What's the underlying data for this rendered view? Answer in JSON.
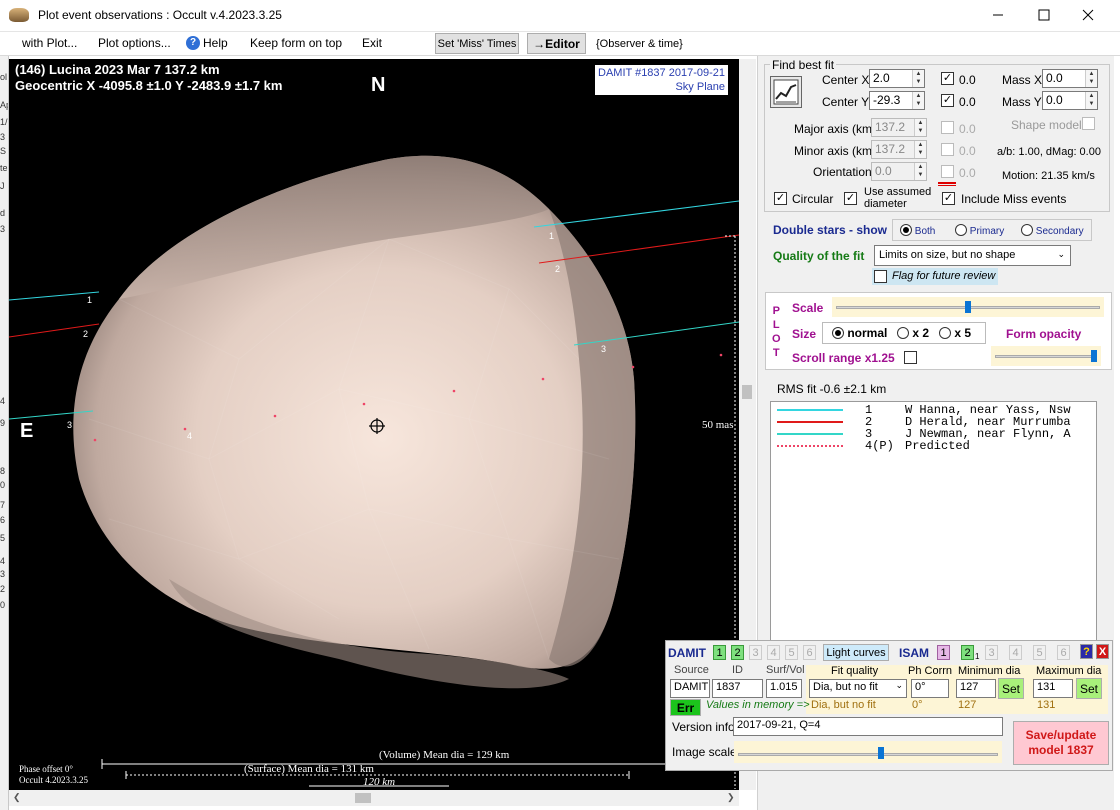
{
  "window": {
    "title": "Plot event observations : Occult v.4.2023.3.25"
  },
  "menu": {
    "with_plot": "with Plot...",
    "plot_options": "Plot options...",
    "help": "Help",
    "keep_form": "Keep form on top",
    "exit": "Exit",
    "set_miss": "Set 'Miss' Times",
    "editor": "→Editor",
    "observer_time": "{Observer & time}"
  },
  "plot": {
    "title_line1": "(146) Lucina  2023 Mar 7   137.2 km",
    "title_line2": "Geocentric  X  -4095.8 ±1.0  Y -2483.9 ±1.7 km",
    "damit_label": "DAMIT #1837 2017-09-21",
    "sky_plane": "Sky Plane",
    "north": "N",
    "east": "E",
    "scale_mas": "50 mas",
    "volume_dia": "(Volume) Mean dia = 129 km",
    "surface_dia": "(Surface) Mean dia = 131 km",
    "scale_km": "120 km",
    "phase_offset": "Phase offset 0°",
    "occult_version": "Occult 4.2023.3.25",
    "chord_labels": [
      "1",
      "2",
      "3",
      "4"
    ]
  },
  "fit": {
    "group_title": "Find best fit",
    "center_x_label": "Center X",
    "center_x": "2.0",
    "center_y_label": "Center Y",
    "center_y": "-29.3",
    "cx_val": "0.0",
    "cy_val": "0.0",
    "mass_x_label": "Mass X",
    "mass_x": "0.0",
    "mass_y_label": "Mass Y",
    "mass_y": "0.0",
    "major_label": "Major axis (km)",
    "major": "137.2",
    "major_val": "0.0",
    "minor_label": "Minor axis (km)",
    "minor": "137.2",
    "minor_val": "0.0",
    "orient_label": "Orientation",
    "orient": "0.0",
    "orient_val": "0.0",
    "shape_model": "Shape model",
    "ab_dmag": "a/b: 1.00, dMag: 0.00",
    "motion": "Motion: 21.35 km/s",
    "circular": "Circular",
    "use_assumed": "Use assumed",
    "diameter": "diameter",
    "include_miss": "Include Miss events"
  },
  "double_stars": {
    "label": "Double stars - show",
    "both": "Both",
    "primary": "Primary",
    "secondary": "Secondary"
  },
  "quality": {
    "label": "Quality of the fit",
    "value": "Limits on size, but no shape",
    "flag": "Flag for future review"
  },
  "plotpanel": {
    "plot_vert": [
      "P",
      "L",
      "O",
      "T"
    ],
    "scale": "Scale",
    "size": "Size",
    "normal": "normal",
    "x2": "x 2",
    "x5": "x 5",
    "form_opacity": "Form opacity",
    "scroll_range": "Scroll range x1.25",
    "scale_level": 0.5,
    "opacity_level": 1.0
  },
  "rms": "RMS fit -0.6 ±2.1 km",
  "legend": [
    {
      "num": "1",
      "name": "W Hanna, near Yass, Nsw",
      "color": "#33d6e0",
      "style": "solid"
    },
    {
      "num": "2",
      "name": "D Herald, near Murrumba",
      "color": "#e01a1a",
      "style": "solid"
    },
    {
      "num": "3",
      "name": "J Newman, near Flynn, A",
      "color": "#33d6c8",
      "style": "solid"
    },
    {
      "num": "4(P)",
      "name": "Predicted",
      "color": "#ee4466",
      "style": "dotted"
    }
  ],
  "damit": {
    "damit": "DAMIT",
    "d_nums": [
      "1",
      "2",
      "3",
      "4",
      "5",
      "6"
    ],
    "light_curves": "Light curves",
    "isam": "ISAM",
    "i_nums": [
      "1",
      "2",
      "3",
      "4",
      "5",
      "6"
    ],
    "i_sub": "1",
    "q": "?",
    "x": "X",
    "source_label": "Source",
    "id_label": "ID",
    "surfvol_label": "Surf/Vol",
    "fit_quality_label": "Fit quality",
    "ph_corrn_label": "Ph Corrn",
    "min_dia_label": "Minimum dia",
    "max_dia_label": "Maximum dia",
    "source": "DAMIT",
    "id": "1837",
    "surfvol": "1.015",
    "fit_quality": "Dia, but no fit",
    "ph_corrn": "0°",
    "min_dia": "127",
    "max_dia": "131",
    "set": "Set",
    "err": "Err",
    "values_in_memory": "Values in memory =>",
    "mem_fit": "Dia, but no fit",
    "mem_ph": "0°",
    "mem_min": "127",
    "mem_max": "131",
    "version_label": "Version info",
    "version": "2017-09-21, Q=4",
    "image_scale": "Image scale",
    "image_scale_level": 0.55,
    "save_update": "Save/update",
    "model": "model 1837"
  },
  "left_strip": [
    "ol",
    "Ap",
    "1/",
    "3",
    "S",
    "te",
    "J",
    "d",
    "3",
    "4",
    "9",
    "8",
    "0",
    "7",
    "6",
    "5",
    "4",
    "3",
    "2",
    "0"
  ]
}
